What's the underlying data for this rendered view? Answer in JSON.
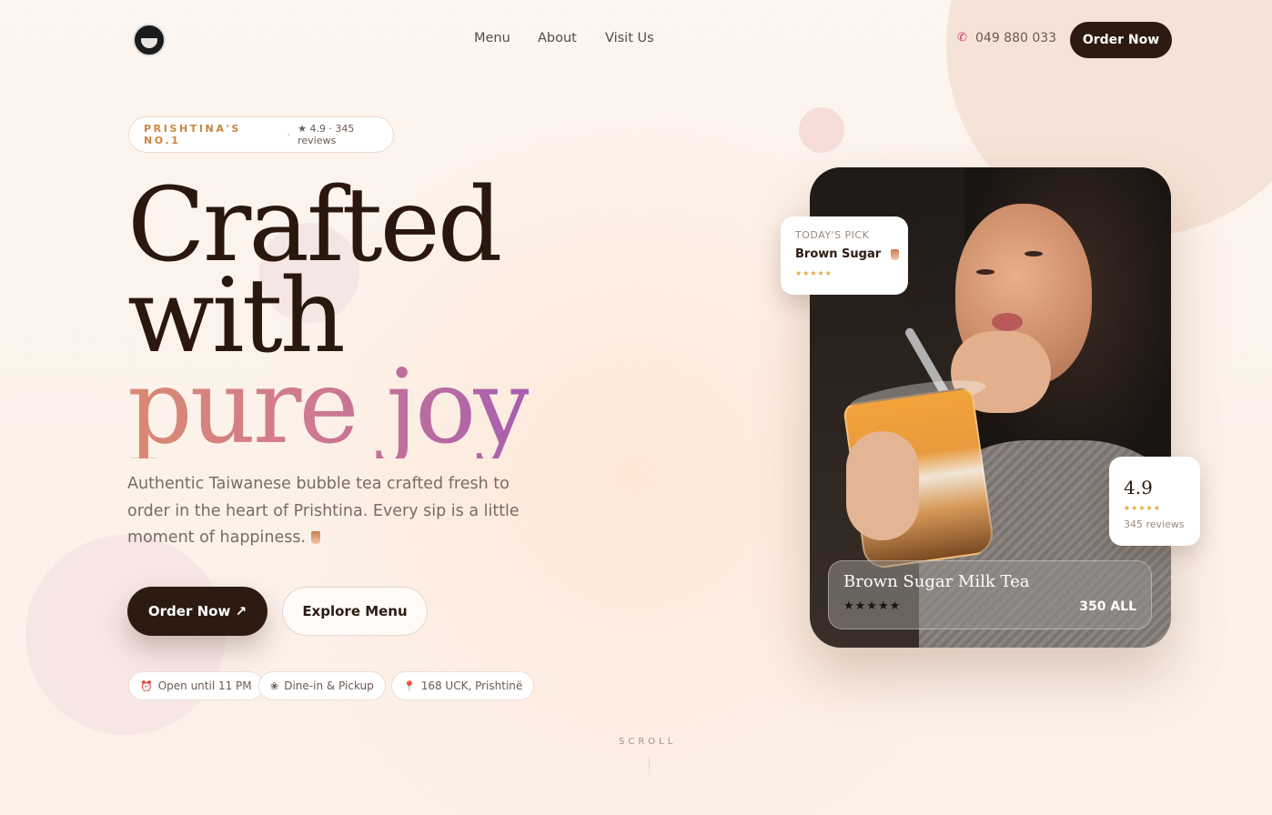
{
  "nav": {
    "items": [
      {
        "label": "Menu"
      },
      {
        "label": "About"
      },
      {
        "label": "Visit Us"
      }
    ],
    "phone": "049 880 033",
    "cta": "Order Now"
  },
  "badge": {
    "title": "PRISHTINA'S NO.1",
    "separator": "·",
    "rating": "★ 4.9 · 345 reviews"
  },
  "hero": {
    "line1": "Crafted",
    "line2": "with",
    "line3": "pure joy",
    "description": "Authentic Taiwanese bubble tea crafted fresh to order in the heart of Prishtina. Every sip is a little moment of happiness.",
    "primary_button": "Order Now ↗",
    "secondary_button": "Explore Menu",
    "chips": [
      {
        "icon": "clock-icon",
        "label": "Open until 11 PM"
      },
      {
        "icon": "dine-icon",
        "label": "Dine-in & Pickup"
      },
      {
        "icon": "location-pin-icon",
        "label": "168 UCK, Prishtinë"
      }
    ],
    "scroll_label": "SCROLL"
  },
  "featured": {
    "todays_pick_label": "TODAY'S PICK",
    "todays_pick_title": "Brown Sugar",
    "todays_pick_stars": "★★★★★",
    "rating_value": "4.9",
    "rating_stars": "★★★★★",
    "rating_reviews": "345 reviews",
    "caption_title": "Brown Sugar Milk Tea",
    "caption_stars": "★★★★★",
    "caption_price": "350 ALL"
  },
  "colors": {
    "accent_dark": "#2d1a10",
    "badge_gold": "#c9853f",
    "gradient_start": "#d98a72",
    "gradient_end": "#a65fb0",
    "star_gold": "#e3a93a",
    "phone_pink": "#d0306a"
  }
}
